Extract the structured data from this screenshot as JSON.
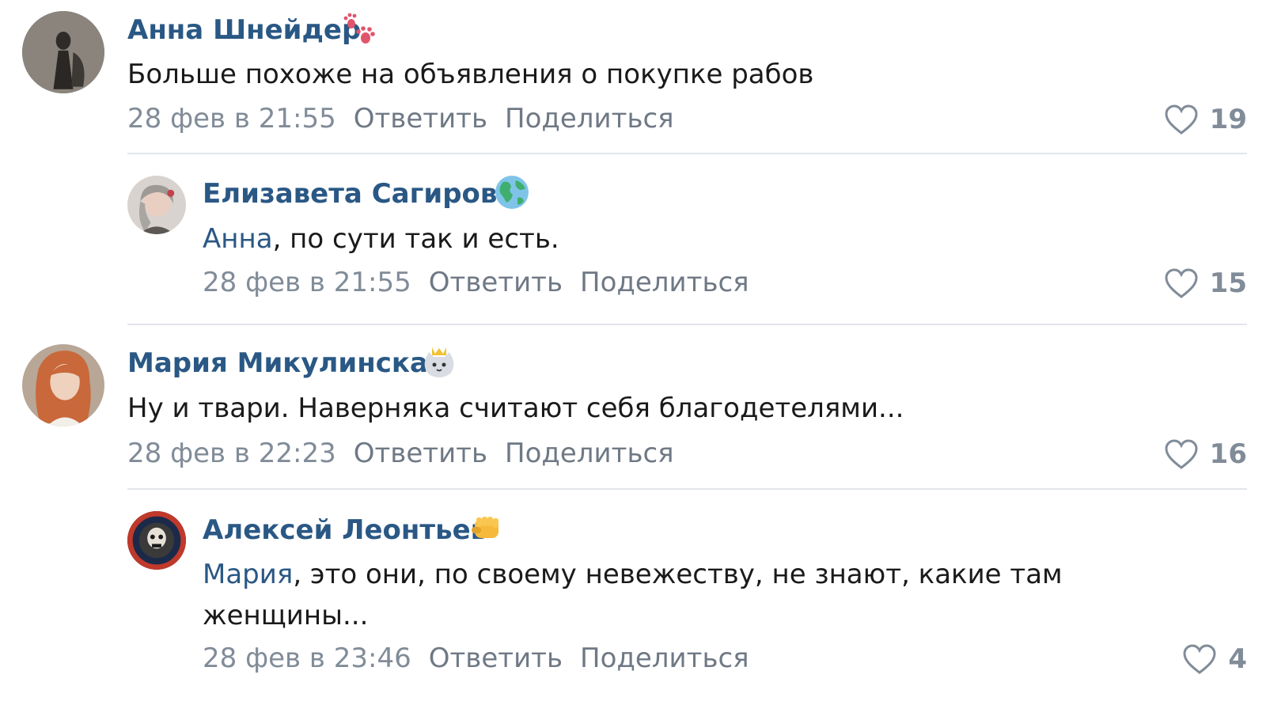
{
  "comments": [
    {
      "author": "Анна Шнейдер",
      "badge_icon": "paw-prints-icon",
      "mention": "",
      "text": "Больше похоже на объявления о покупке рабов",
      "date": "28 фев в 21:55",
      "reply_label": "Ответить",
      "share_label": "Поделиться",
      "likes": "19"
    },
    {
      "author": "Елизавета Сагирова",
      "badge_icon": "globe-icon",
      "mention": "Анна",
      "text": ", по сути так и есть.",
      "date": "28 фев в 21:55",
      "reply_label": "Ответить",
      "share_label": "Поделиться",
      "likes": "15"
    },
    {
      "author": "Мария Микулинская",
      "badge_icon": "crowned-cat-icon",
      "mention": "",
      "text": "Ну и твари. Наверняка считают себя благодетелями...",
      "date": "28 фев в 22:23",
      "reply_label": "Ответить",
      "share_label": "Поделиться",
      "likes": "16"
    },
    {
      "author": "Алексей Леонтьев",
      "badge_icon": "fist-icon",
      "mention": "Мария",
      "text": ", это они, по своему невежеству, не знают, какие там",
      "text_line2": "женщины...",
      "date": "28 фев в 23:46",
      "reply_label": "Ответить",
      "share_label": "Поделиться",
      "likes": "4"
    }
  ],
  "colors": {
    "author": "#2a5885",
    "meta": "#818c99",
    "divider": "#e3e6ea"
  }
}
